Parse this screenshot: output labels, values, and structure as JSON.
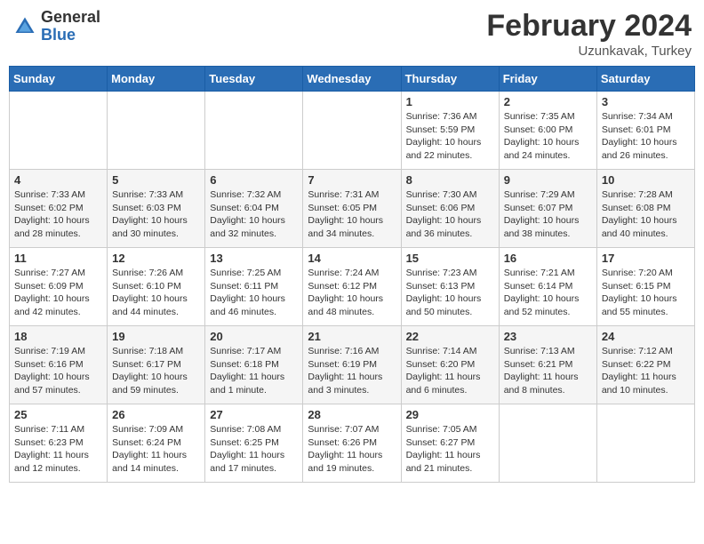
{
  "header": {
    "logo_general": "General",
    "logo_blue": "Blue",
    "month_year": "February 2024",
    "location": "Uzunkavak, Turkey"
  },
  "weekdays": [
    "Sunday",
    "Monday",
    "Tuesday",
    "Wednesday",
    "Thursday",
    "Friday",
    "Saturday"
  ],
  "weeks": [
    [
      {
        "day": "",
        "info": ""
      },
      {
        "day": "",
        "info": ""
      },
      {
        "day": "",
        "info": ""
      },
      {
        "day": "",
        "info": ""
      },
      {
        "day": "1",
        "info": "Sunrise: 7:36 AM\nSunset: 5:59 PM\nDaylight: 10 hours\nand 22 minutes."
      },
      {
        "day": "2",
        "info": "Sunrise: 7:35 AM\nSunset: 6:00 PM\nDaylight: 10 hours\nand 24 minutes."
      },
      {
        "day": "3",
        "info": "Sunrise: 7:34 AM\nSunset: 6:01 PM\nDaylight: 10 hours\nand 26 minutes."
      }
    ],
    [
      {
        "day": "4",
        "info": "Sunrise: 7:33 AM\nSunset: 6:02 PM\nDaylight: 10 hours\nand 28 minutes."
      },
      {
        "day": "5",
        "info": "Sunrise: 7:33 AM\nSunset: 6:03 PM\nDaylight: 10 hours\nand 30 minutes."
      },
      {
        "day": "6",
        "info": "Sunrise: 7:32 AM\nSunset: 6:04 PM\nDaylight: 10 hours\nand 32 minutes."
      },
      {
        "day": "7",
        "info": "Sunrise: 7:31 AM\nSunset: 6:05 PM\nDaylight: 10 hours\nand 34 minutes."
      },
      {
        "day": "8",
        "info": "Sunrise: 7:30 AM\nSunset: 6:06 PM\nDaylight: 10 hours\nand 36 minutes."
      },
      {
        "day": "9",
        "info": "Sunrise: 7:29 AM\nSunset: 6:07 PM\nDaylight: 10 hours\nand 38 minutes."
      },
      {
        "day": "10",
        "info": "Sunrise: 7:28 AM\nSunset: 6:08 PM\nDaylight: 10 hours\nand 40 minutes."
      }
    ],
    [
      {
        "day": "11",
        "info": "Sunrise: 7:27 AM\nSunset: 6:09 PM\nDaylight: 10 hours\nand 42 minutes."
      },
      {
        "day": "12",
        "info": "Sunrise: 7:26 AM\nSunset: 6:10 PM\nDaylight: 10 hours\nand 44 minutes."
      },
      {
        "day": "13",
        "info": "Sunrise: 7:25 AM\nSunset: 6:11 PM\nDaylight: 10 hours\nand 46 minutes."
      },
      {
        "day": "14",
        "info": "Sunrise: 7:24 AM\nSunset: 6:12 PM\nDaylight: 10 hours\nand 48 minutes."
      },
      {
        "day": "15",
        "info": "Sunrise: 7:23 AM\nSunset: 6:13 PM\nDaylight: 10 hours\nand 50 minutes."
      },
      {
        "day": "16",
        "info": "Sunrise: 7:21 AM\nSunset: 6:14 PM\nDaylight: 10 hours\nand 52 minutes."
      },
      {
        "day": "17",
        "info": "Sunrise: 7:20 AM\nSunset: 6:15 PM\nDaylight: 10 hours\nand 55 minutes."
      }
    ],
    [
      {
        "day": "18",
        "info": "Sunrise: 7:19 AM\nSunset: 6:16 PM\nDaylight: 10 hours\nand 57 minutes."
      },
      {
        "day": "19",
        "info": "Sunrise: 7:18 AM\nSunset: 6:17 PM\nDaylight: 10 hours\nand 59 minutes."
      },
      {
        "day": "20",
        "info": "Sunrise: 7:17 AM\nSunset: 6:18 PM\nDaylight: 11 hours\nand 1 minute."
      },
      {
        "day": "21",
        "info": "Sunrise: 7:16 AM\nSunset: 6:19 PM\nDaylight: 11 hours\nand 3 minutes."
      },
      {
        "day": "22",
        "info": "Sunrise: 7:14 AM\nSunset: 6:20 PM\nDaylight: 11 hours\nand 6 minutes."
      },
      {
        "day": "23",
        "info": "Sunrise: 7:13 AM\nSunset: 6:21 PM\nDaylight: 11 hours\nand 8 minutes."
      },
      {
        "day": "24",
        "info": "Sunrise: 7:12 AM\nSunset: 6:22 PM\nDaylight: 11 hours\nand 10 minutes."
      }
    ],
    [
      {
        "day": "25",
        "info": "Sunrise: 7:11 AM\nSunset: 6:23 PM\nDaylight: 11 hours\nand 12 minutes."
      },
      {
        "day": "26",
        "info": "Sunrise: 7:09 AM\nSunset: 6:24 PM\nDaylight: 11 hours\nand 14 minutes."
      },
      {
        "day": "27",
        "info": "Sunrise: 7:08 AM\nSunset: 6:25 PM\nDaylight: 11 hours\nand 17 minutes."
      },
      {
        "day": "28",
        "info": "Sunrise: 7:07 AM\nSunset: 6:26 PM\nDaylight: 11 hours\nand 19 minutes."
      },
      {
        "day": "29",
        "info": "Sunrise: 7:05 AM\nSunset: 6:27 PM\nDaylight: 11 hours\nand 21 minutes."
      },
      {
        "day": "",
        "info": ""
      },
      {
        "day": "",
        "info": ""
      }
    ]
  ]
}
